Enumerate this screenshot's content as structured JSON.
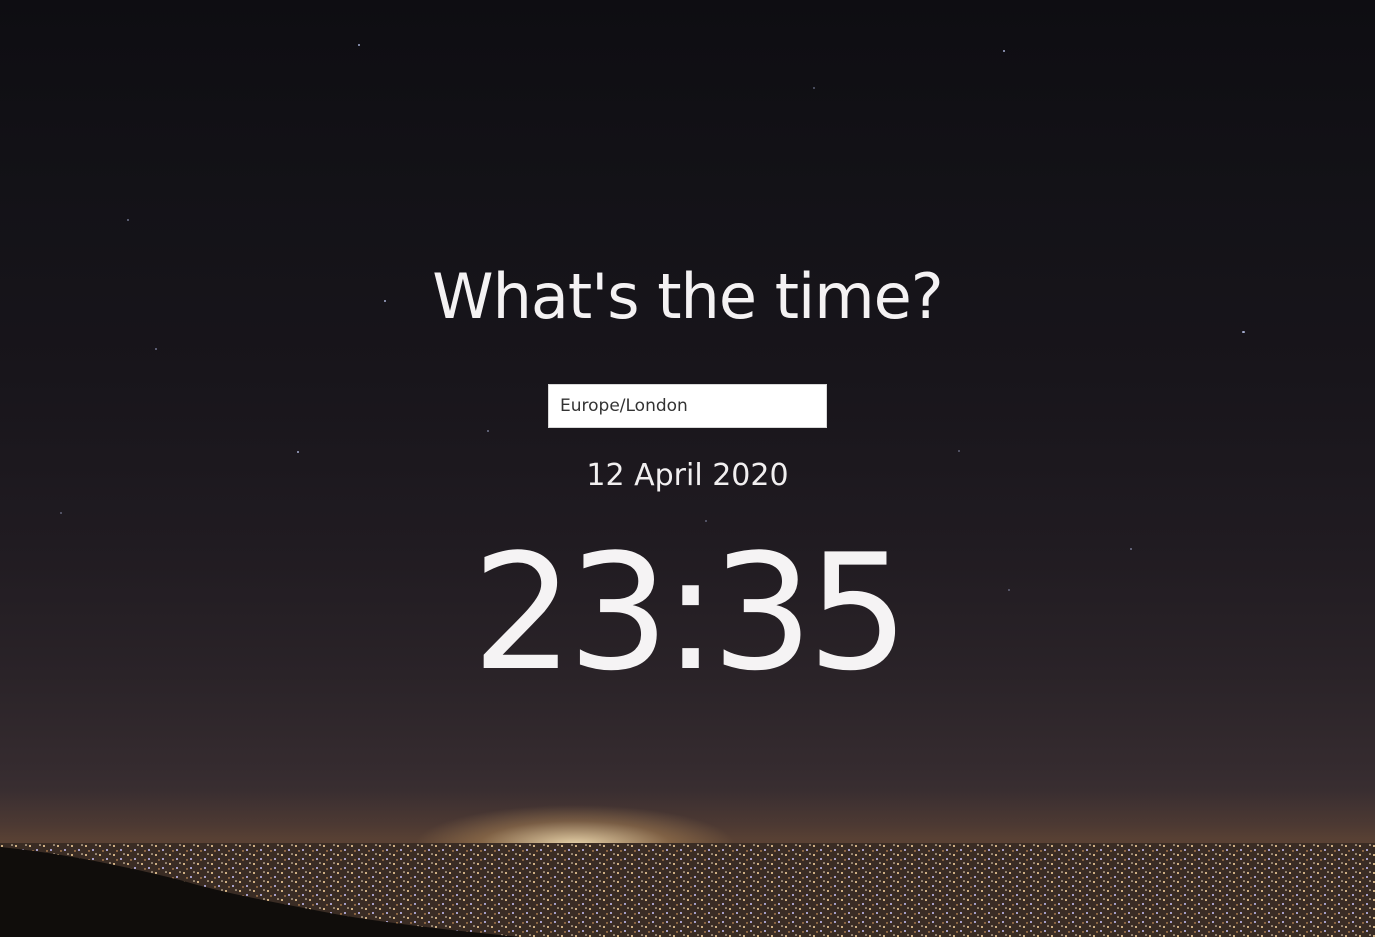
{
  "header": {
    "title": "What's the time?"
  },
  "timezone": {
    "value": "Europe/London",
    "placeholder": ""
  },
  "date": {
    "text": "12 April 2020"
  },
  "clock": {
    "time": "23:35"
  },
  "colors": {
    "text": "#f4f2f3",
    "input_bg": "#ffffff",
    "sky_top": "#0e0d12",
    "city_light": "#ffebbe"
  }
}
